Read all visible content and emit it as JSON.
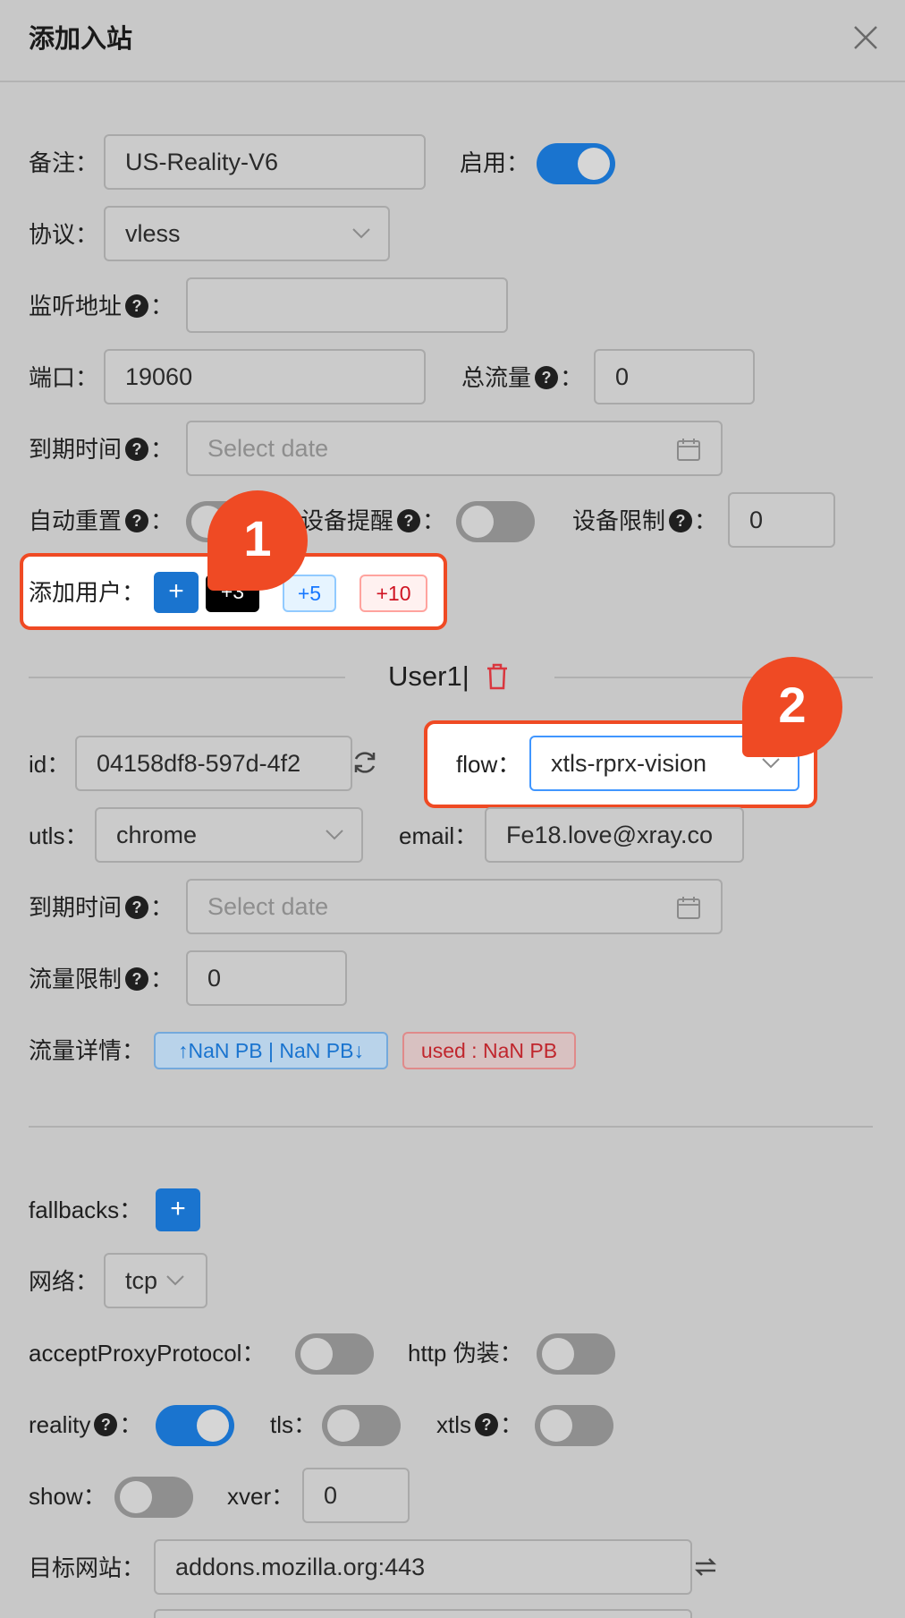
{
  "header": {
    "title": "添加入站"
  },
  "form": {
    "remark_label": "备注：",
    "remark_value": "US-Reality-V6",
    "enable_label": "启用：",
    "protocol_label": "协议：",
    "protocol_value": "vless",
    "listen_label": "监听地址",
    "colon": "：",
    "port_label": "端口：",
    "port_value": "19060",
    "total_label": "总流量",
    "total_value": "0",
    "expire_label": "到期时间",
    "date_placeholder": "Select date",
    "auto_reset_label": "自动重置",
    "device_alert_label": "设备提醒",
    "device_limit_label": "设备限制",
    "device_limit_value": "0",
    "add_user_label": "添加用户：",
    "add_plus": "+",
    "add_3": "+3",
    "add_5": "+5",
    "add_10": "+10"
  },
  "user": {
    "heading": "User1|",
    "id_label": "id：",
    "id_value": "04158df8-597d-4f2",
    "flow_label": "flow：",
    "flow_value": "xtls-rprx-vision",
    "utls_label": "utls：",
    "utls_value": "chrome",
    "email_label": "email：",
    "email_value": "Fe18.love@xray.co",
    "expire_label": "到期时间",
    "traffic_limit_label": "流量限制",
    "traffic_limit_value": "0",
    "traffic_detail_label": "流量详情：",
    "traffic_tag": "↑NaN PB | NaN PB↓",
    "used_tag": "used : NaN PB"
  },
  "advanced": {
    "fallbacks_label": "fallbacks：",
    "fallbacks_plus": "+",
    "network_label": "网络：",
    "network_value": "tcp",
    "accept_proxy_label": "acceptProxyProtocol：",
    "http_label": "http 伪装：",
    "reality_label": "reality",
    "tls_label": "tls：",
    "xtls_label": "xtls",
    "show_label": "show：",
    "xver_label": "xver：",
    "xver_value": "0",
    "dest_label": "目标网站：",
    "dest_value": "addons.mozilla.org:443"
  },
  "annotations": {
    "badge1": "1",
    "badge2": "2"
  },
  "colors": {
    "accent": "#1a74cf",
    "highlight": "#ef4a24",
    "danger": "#d9363e"
  },
  "icons": [
    "close-icon",
    "chevron-down-icon",
    "calendar-icon",
    "question-icon",
    "refresh-icon",
    "trash-icon",
    "swap-icon"
  ]
}
